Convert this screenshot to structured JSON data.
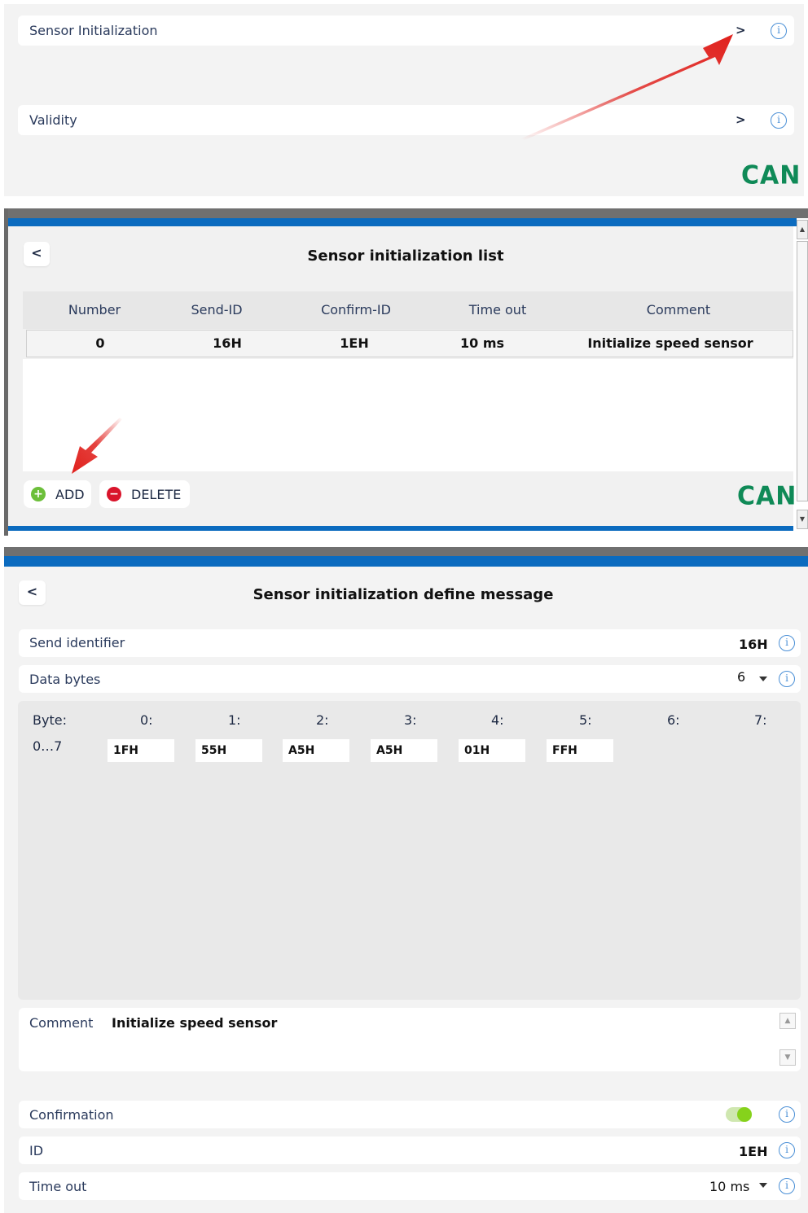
{
  "panel1": {
    "sensor_init_label": "Sensor Initialization",
    "validity_label": "Validity",
    "can_logo": "CAN"
  },
  "list_dialog": {
    "title": "Sensor initialization list",
    "columns": [
      "Number",
      "Send-ID",
      "Confirm-ID",
      "Time out",
      "Comment"
    ],
    "rows": [
      {
        "number": "0",
        "send_id": "16H",
        "confirm_id": "1EH",
        "time_out": "10 ms",
        "comment": "Initialize speed sensor"
      }
    ],
    "add_label": "ADD",
    "delete_label": "DELETE",
    "can_logo": "CAN"
  },
  "define_dialog": {
    "title": "Sensor initialization define message",
    "send_identifier_label": "Send identifier",
    "send_identifier_value": "16H",
    "data_bytes_label": "Data bytes",
    "data_bytes_value": "6",
    "byte_label": "Byte:",
    "byte_range": "0…7",
    "byte_indexes": [
      "0:",
      "1:",
      "2:",
      "3:",
      "4:",
      "5:",
      "6:",
      "7:"
    ],
    "byte_values": [
      "1FH",
      "55H",
      "A5H",
      "A5H",
      "01H",
      "FFH"
    ],
    "comment_label": "Comment",
    "comment_value": "Initialize speed sensor",
    "confirmation_label": "Confirmation",
    "confirmation_on": true,
    "id_label": "ID",
    "id_value": "1EH",
    "timeout_label": "Time out",
    "timeout_value": "10 ms"
  },
  "colors": {
    "accent_blue": "#0b6bbf",
    "can_green": "#0f8a57",
    "add_green": "#6cbf3a",
    "delete_red": "#d9142b",
    "toggle_green": "#86d21b",
    "info_blue": "#4a8fd6",
    "arrow_red": "#e0201c"
  }
}
